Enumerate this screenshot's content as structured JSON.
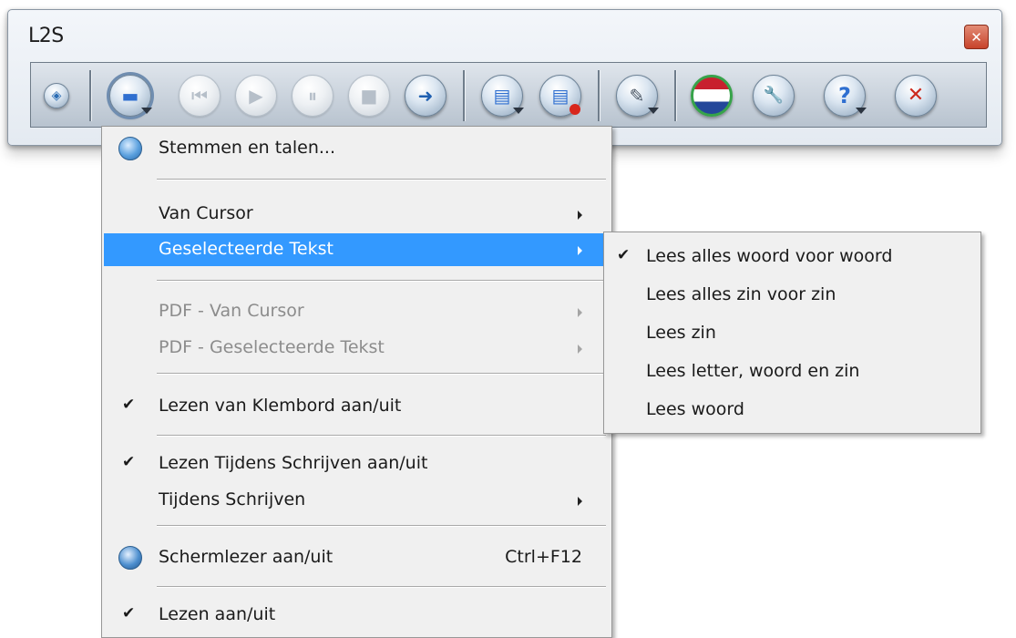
{
  "window": {
    "title": "L2S",
    "close_glyph": "✕"
  },
  "toolbar": {
    "buttons": [
      {
        "name": "app-icon",
        "glyph": "◈",
        "state": "normal"
      },
      {
        "name": "speech-menu-button",
        "glyph": "▬",
        "state": "active",
        "dropdown": true
      },
      {
        "name": "previous-button",
        "glyph": "⏮",
        "state": "disabled"
      },
      {
        "name": "play-button",
        "glyph": "▶",
        "state": "disabled"
      },
      {
        "name": "pause-button",
        "glyph": "⏸",
        "state": "disabled"
      },
      {
        "name": "stop-button",
        "glyph": "■",
        "state": "disabled"
      },
      {
        "name": "next-button",
        "glyph": "➜",
        "state": "normal"
      },
      {
        "name": "document-button",
        "glyph": "▤",
        "state": "normal",
        "dropdown": true
      },
      {
        "name": "document-power-button",
        "glyph": "▤",
        "state": "normal"
      },
      {
        "name": "tools-button",
        "glyph": "✎",
        "state": "normal",
        "dropdown": true
      },
      {
        "name": "language-flag-button",
        "glyph": "≡",
        "state": "normal"
      },
      {
        "name": "settings-button",
        "glyph": "🔧",
        "state": "normal"
      },
      {
        "name": "help-button",
        "glyph": "?",
        "state": "normal",
        "dropdown": true
      },
      {
        "name": "exit-button",
        "glyph": "✕",
        "state": "normal"
      }
    ]
  },
  "menu": {
    "items": [
      {
        "label": "Stemmen en talen..."
      },
      {
        "label": "Van Cursor"
      },
      {
        "label": "Geselecteerde Tekst"
      },
      {
        "label": "PDF - Van Cursor"
      },
      {
        "label": "PDF - Geselecteerde Tekst"
      },
      {
        "label": "Lezen van Klembord aan/uit",
        "check": "✔"
      },
      {
        "label": "Lezen Tijdens Schrijven aan/uit",
        "check": "✔"
      },
      {
        "label": "Tijdens Schrijven"
      },
      {
        "label": "Schermlezer aan/uit",
        "shortcut": "Ctrl+F12"
      },
      {
        "label": "Lezen aan/uit",
        "check": "✔"
      }
    ]
  },
  "submenu": {
    "items": [
      {
        "label": "Lees alles woord voor woord",
        "check": "✔"
      },
      {
        "label": "Lees alles zin voor zin"
      },
      {
        "label": "Lees zin"
      },
      {
        "label": "Lees letter, woord en zin"
      },
      {
        "label": "Lees woord"
      }
    ]
  },
  "colors": {
    "highlight": "#3399ff",
    "flag_red": "#c8202e",
    "flag_blue": "#24479a",
    "exit_red": "#cc2a1e",
    "help_blue": "#2f6fd0",
    "power_red": "#d8261c"
  }
}
